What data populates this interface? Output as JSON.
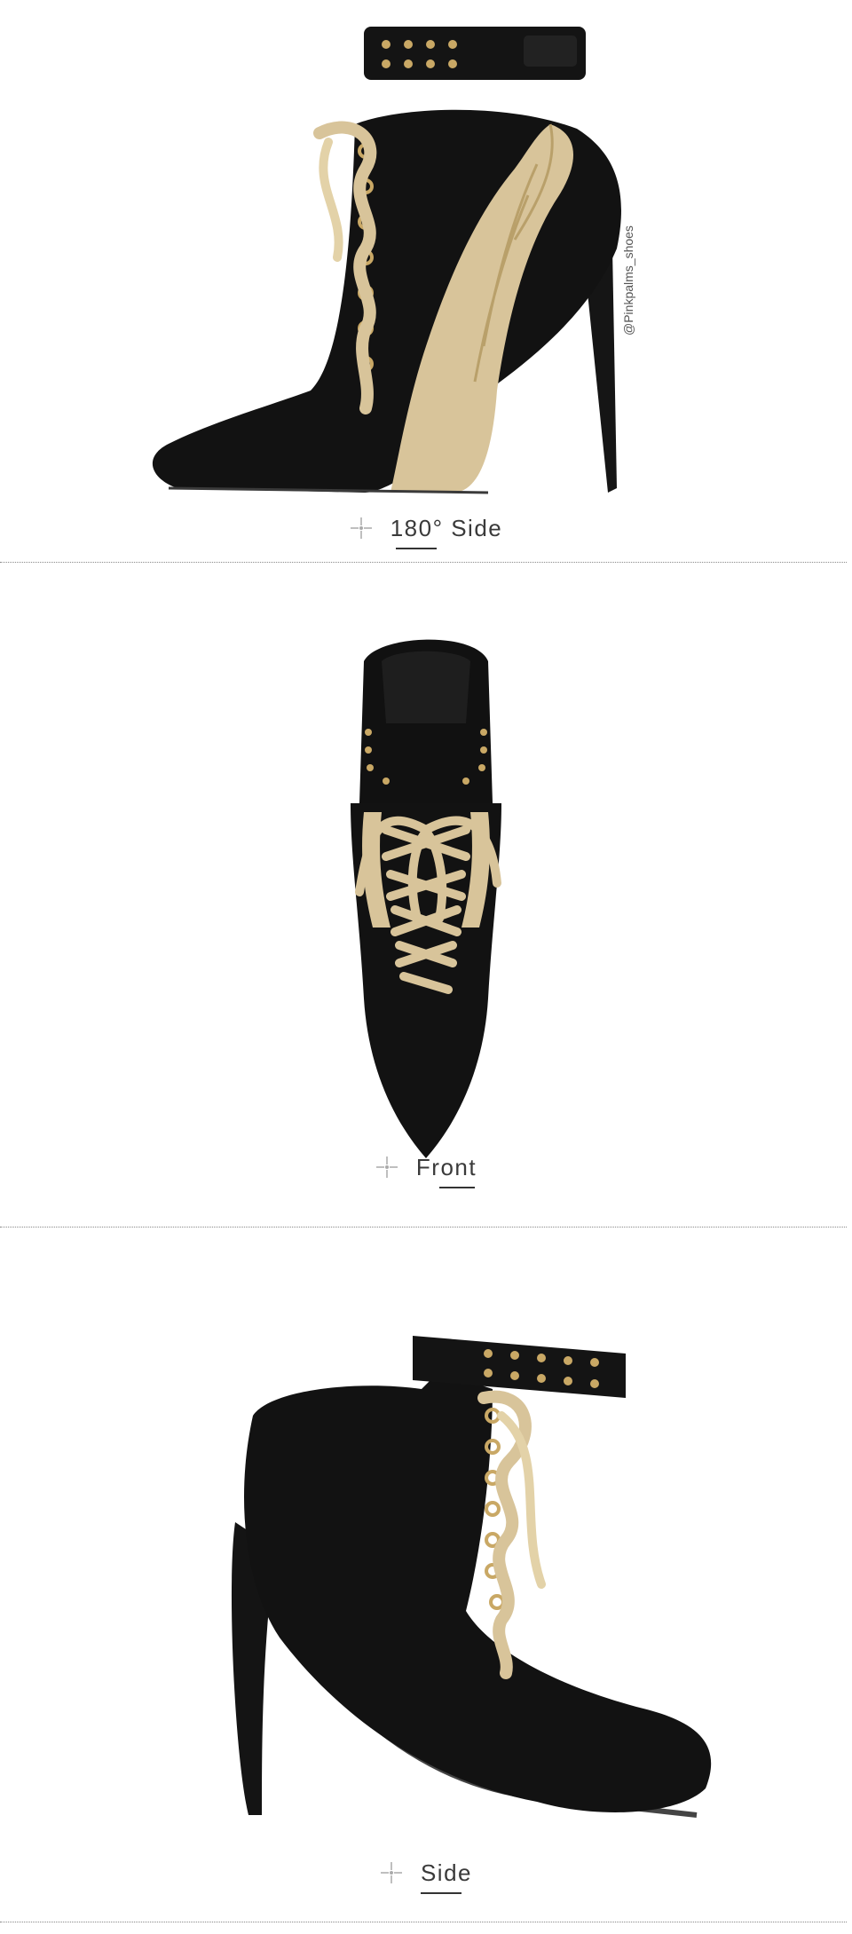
{
  "watermark": "@Pinkpalms_shoes",
  "views": [
    {
      "caption": "180° Side"
    },
    {
      "caption": "Front"
    },
    {
      "caption": "Side"
    }
  ],
  "colors": {
    "suede": "#111111",
    "gold": "#d8c49a",
    "gold_dark": "#b9a06a",
    "divider": "#888888"
  },
  "icons": {
    "caption_marker": "crosshair-sparkle-icon"
  }
}
